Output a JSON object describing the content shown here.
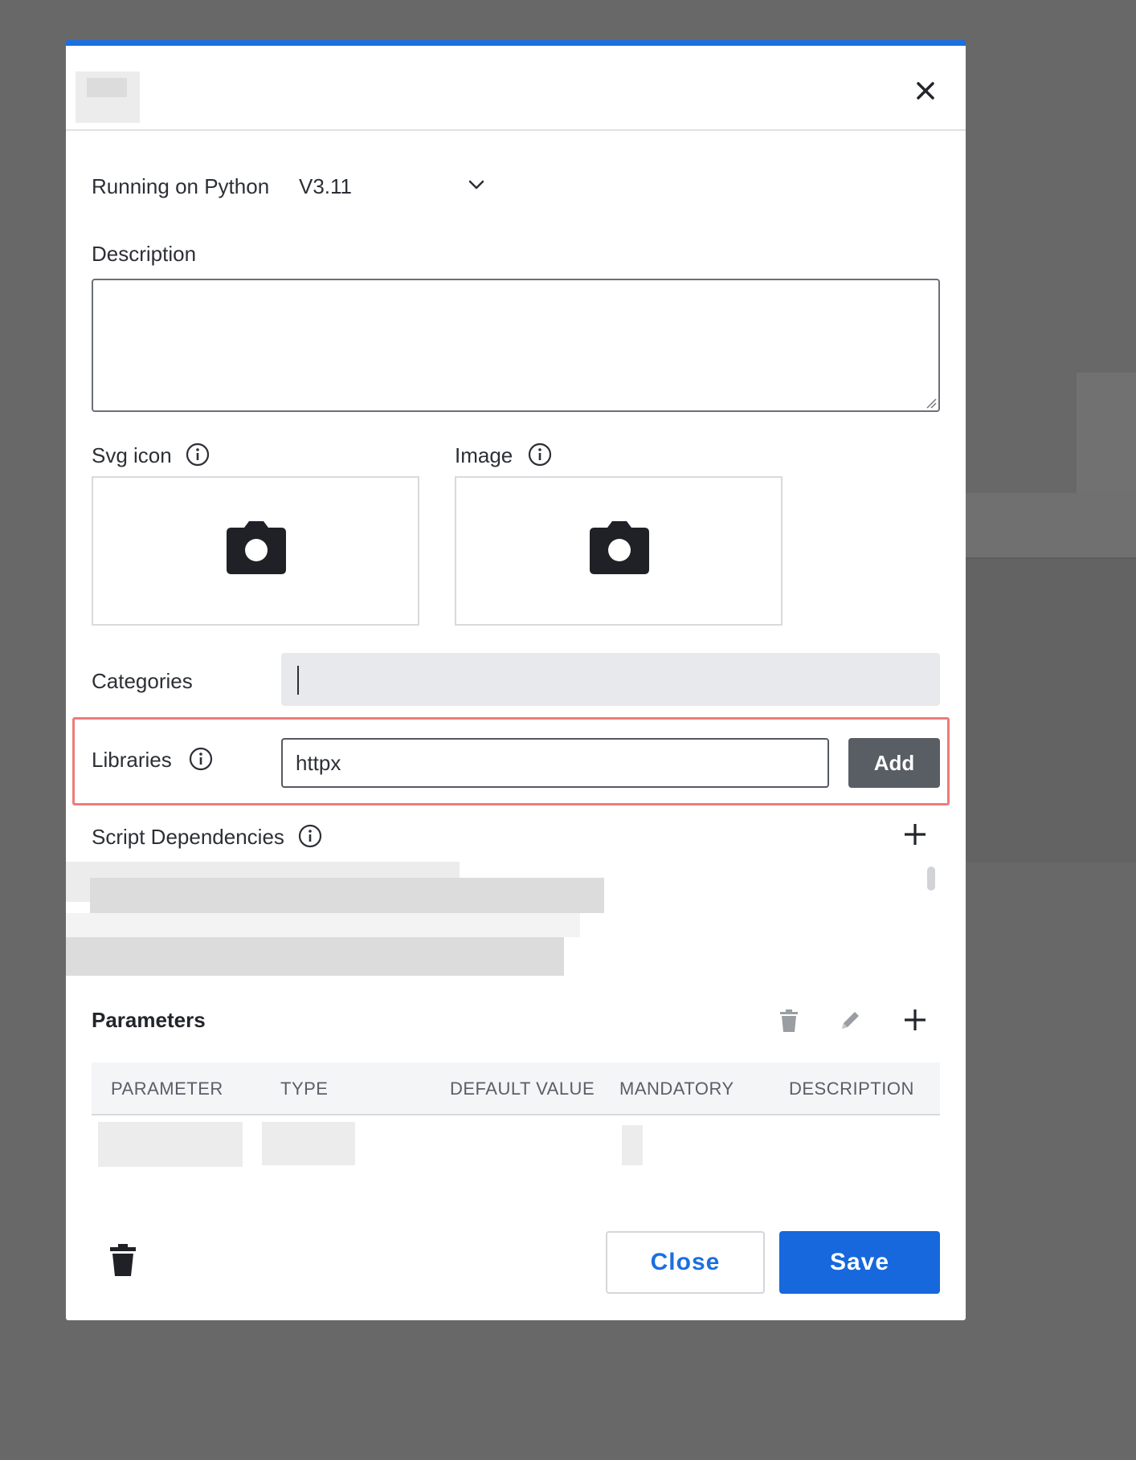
{
  "dialog": {
    "close_icon": "close-icon",
    "runtime": {
      "label": "Running on Python",
      "value": "V3.11",
      "chevron": "chevron-down-icon"
    },
    "description": {
      "label": "Description",
      "value": ""
    },
    "svg_icon": {
      "label": "Svg icon",
      "info": "info-icon",
      "upload_icon": "camera-icon"
    },
    "image": {
      "label": "Image",
      "info": "info-icon",
      "upload_icon": "camera-icon"
    },
    "categories": {
      "label": "Categories",
      "value": ""
    },
    "libraries": {
      "label": "Libraries",
      "value": "httpx",
      "add_label": "Add"
    },
    "script_dependencies": {
      "label": "Script Dependencies",
      "add_icon": "plus-icon"
    },
    "parameters": {
      "title": "Parameters",
      "columns": [
        "PARAMETER",
        "TYPE",
        "DEFAULT VALUE",
        "MANDATORY",
        "DESCRIPTION"
      ],
      "actions": [
        "trash-icon",
        "pencil-icon",
        "plus-icon"
      ]
    },
    "footer": {
      "close_label": "Close",
      "save_label": "Save",
      "delete_icon": "trash-icon"
    }
  },
  "colors": {
    "accent": "#1b6fe0",
    "highlight_border": "#ef7b7b",
    "add_button": "#595d64"
  }
}
